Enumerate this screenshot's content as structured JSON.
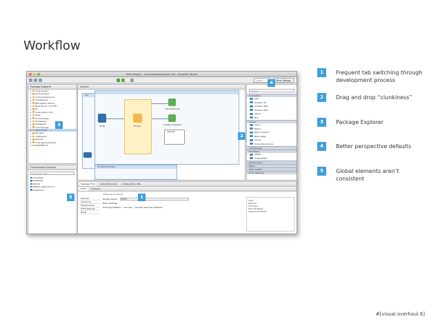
{
  "slide": {
    "title": "Workflow",
    "footer": "#[visual.overhaul.6]"
  },
  "window": {
    "title": "Mule Design – /src/main/app/service.xml – Anypoint Studio",
    "quick_access": "Quick Access",
    "perspective": "Mule Design"
  },
  "package_explorer": {
    "tab_label": "Package Explorer",
    "items": [
      {
        "label": "mule-project",
        "selected": false
      },
      {
        "label": "src/main/java",
        "selected": false
      },
      {
        "label": "src/main/resources",
        "selected": false
      },
      {
        "label": "src/test/java",
        "selected": false
      },
      {
        "label": "JRE System Library",
        "selected": false
      },
      {
        "label": "Mule Server 3.5.0 EE",
        "selected": false
      },
      {
        "label": "lib",
        "selected": false
      },
      {
        "label": "mule-project.xml",
        "selected": false
      },
      {
        "label": "flows",
        "selected": false
      },
      {
        "label": "src/main/app",
        "selected": false
      },
      {
        "label": "hardwarep...",
        "selected": false
      },
      {
        "label": "hardwarep...",
        "selected": false
      },
      {
        "label": "src/main/app",
        "selected": false
      },
      {
        "label": "service.xml",
        "selected": true
      },
      {
        "label": "test.json",
        "selected": false
      },
      {
        "label": "create.json",
        "selected": false
      },
      {
        "label": "get.json",
        "selected": false
      },
      {
        "label": "mule-app.properties",
        "selected": false
      },
      {
        "label": "README.md",
        "selected": false
      }
    ]
  },
  "connections": {
    "tab_label": "Connections Explorer",
    "search_placeholder": "type filter text",
    "items": [
      "CloudHub",
      "Database",
      "Github",
      "MySQL_Data_Source",
      "Salesforce"
    ]
  },
  "editor": {
    "tab_label": "service",
    "flow1_title": "api",
    "flow2_title": "hardwareFlowGet",
    "nodes": [
      {
        "label": "HTTP"
      },
      {
        "label": "Choice"
      },
      {
        "label": "Get employee"
      },
      {
        "label": "Create employee"
      },
      {
        "label": "Default"
      },
      {
        "label": "Adding Engineer to Team"
      },
      {
        "label": "Github"
      },
      {
        "label": "Logger"
      }
    ],
    "bottom_tabs": [
      "Message Flow",
      "Global Elements",
      "Configuration XML"
    ]
  },
  "palette": {
    "search_placeholder": "Search",
    "sections": [
      {
        "title": "Connectors",
        "items": [
          "Ajax",
          "Amazon S3",
          "Amazon SNS",
          "Amazon SQS",
          "Atmos",
          "Box"
        ]
      },
      {
        "title": "Scopes",
        "items": [
          "Async",
          "Batch",
          "Batch Commit",
          "Batch Step",
          "Cache",
          "Composite Source"
        ]
      },
      {
        "title": "Components",
        "items": []
      },
      {
        "title": "Endpoints",
        "items": [
          "AMQP",
          "HTTP/HTTPS"
        ]
      },
      {
        "title": "Transformers",
        "items": []
      },
      {
        "title": "Filters",
        "items": []
      },
      {
        "title": "Flow Control",
        "items": []
      },
      {
        "title": "Error Handling",
        "items": []
      }
    ]
  },
  "properties": {
    "tabs": [
      "HTTP",
      "Problems"
    ],
    "warning": "There are no errors.",
    "nav": [
      "General",
      "Advanced",
      "Transformers",
      "HTTP Settings",
      "Notes"
    ],
    "display_name_label": "Display Name:",
    "display_name_value": "HTTP",
    "basic_settings": "Basic Settings",
    "exchange_label": "Exchange Pattern:",
    "exchange_opt1": "one-way",
    "exchange_opt2": "request-response (Default)",
    "side_title": "Input",
    "side_items": [
      "Payload",
      "Unknown",
      "Flow Variables",
      "Session Variables"
    ]
  },
  "badges": [
    "1",
    "2",
    "3",
    "4",
    "5"
  ],
  "notes": [
    {
      "num": "1",
      "text": "Frequent tab switching through development process"
    },
    {
      "num": "2",
      "text": "Drag and drop “clunkiness”"
    },
    {
      "num": "3",
      "text": "Package Explorer"
    },
    {
      "num": "4",
      "text": "Better perspective defaults"
    },
    {
      "num": "5",
      "text": "Global elements aren’t consistent"
    }
  ],
  "colors": {
    "accent": "#3f9fd8",
    "flow_header": "#cfe0f3",
    "choice_node": "#f2b84b"
  }
}
